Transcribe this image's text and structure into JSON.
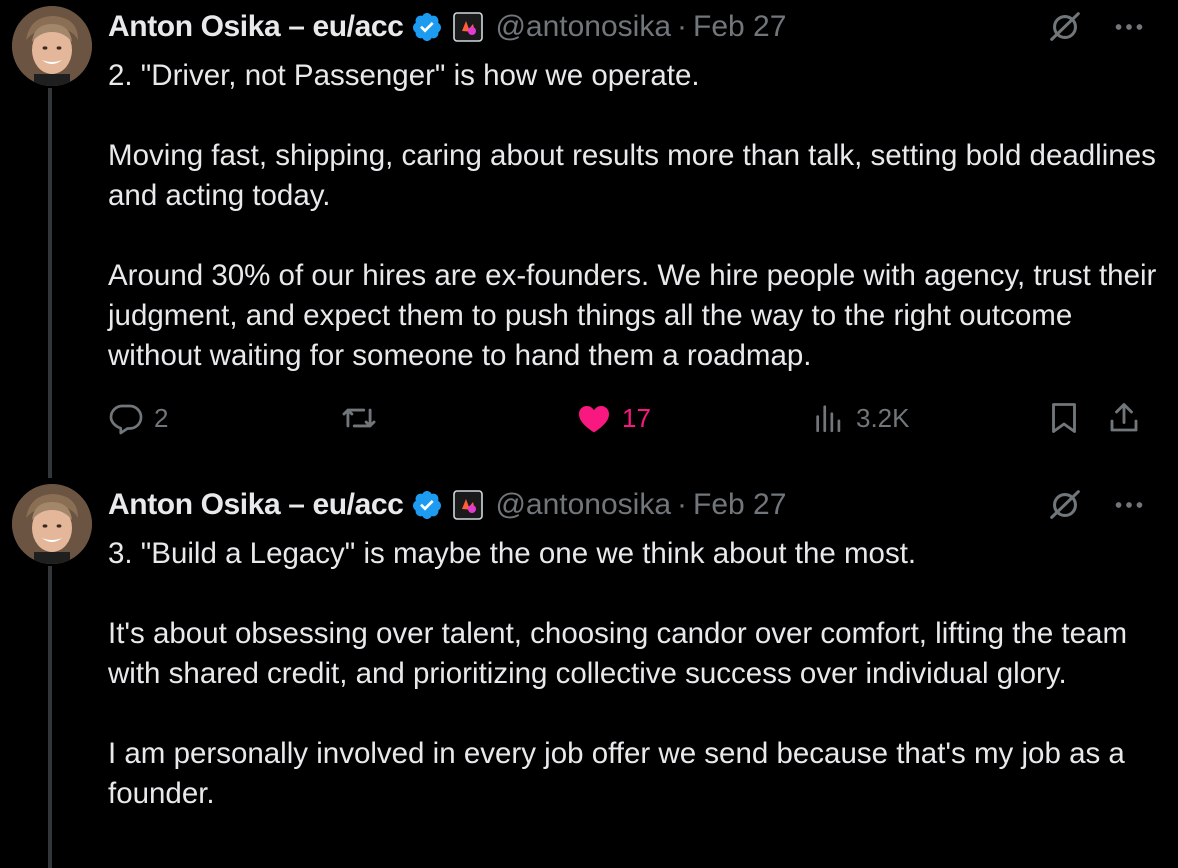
{
  "tweets": [
    {
      "author_name": "Anton Osika – eu/acc",
      "handle": "@antonosika",
      "separator": "·",
      "date": "Feb 27",
      "paragraphs": [
        "2. \"Driver, not Passenger\" is how we operate.",
        "Moving fast, shipping, caring about results more than talk, setting bold deadlines and acting today.",
        "Around 30% of our hires are ex-founders. We hire people with agency, trust their judgment, and expect them to push things all the way to the right outcome without waiting for someone to hand them a roadmap."
      ],
      "stats": {
        "replies": "2",
        "reposts": "",
        "likes": "17",
        "views": "3.2K"
      },
      "liked": true
    },
    {
      "author_name": "Anton Osika – eu/acc",
      "handle": "@antonosika",
      "separator": "·",
      "date": "Feb 27",
      "paragraphs": [
        "3. \"Build a Legacy\" is maybe the one we think about the most.",
        "It's about obsessing over talent, choosing candor over comfort, lifting the team with shared credit, and prioritizing collective success over individual glory.",
        "I am personally involved in every job offer we send because that's my job as a founder."
      ]
    }
  ],
  "icons": {
    "verified": "verified-badge-icon",
    "affiliate": "affiliate-badge-icon",
    "grok": "grok-icon",
    "more": "more-icon",
    "reply": "reply-icon",
    "repost": "repost-icon",
    "like": "heart-icon",
    "views": "views-icon",
    "bookmark": "bookmark-icon",
    "share": "share-icon"
  },
  "colors": {
    "background": "#000000",
    "text": "#e7e9ea",
    "secondary": "#71767b",
    "verified": "#1d9bf0",
    "like": "#f91880",
    "thread_line": "#333639"
  }
}
